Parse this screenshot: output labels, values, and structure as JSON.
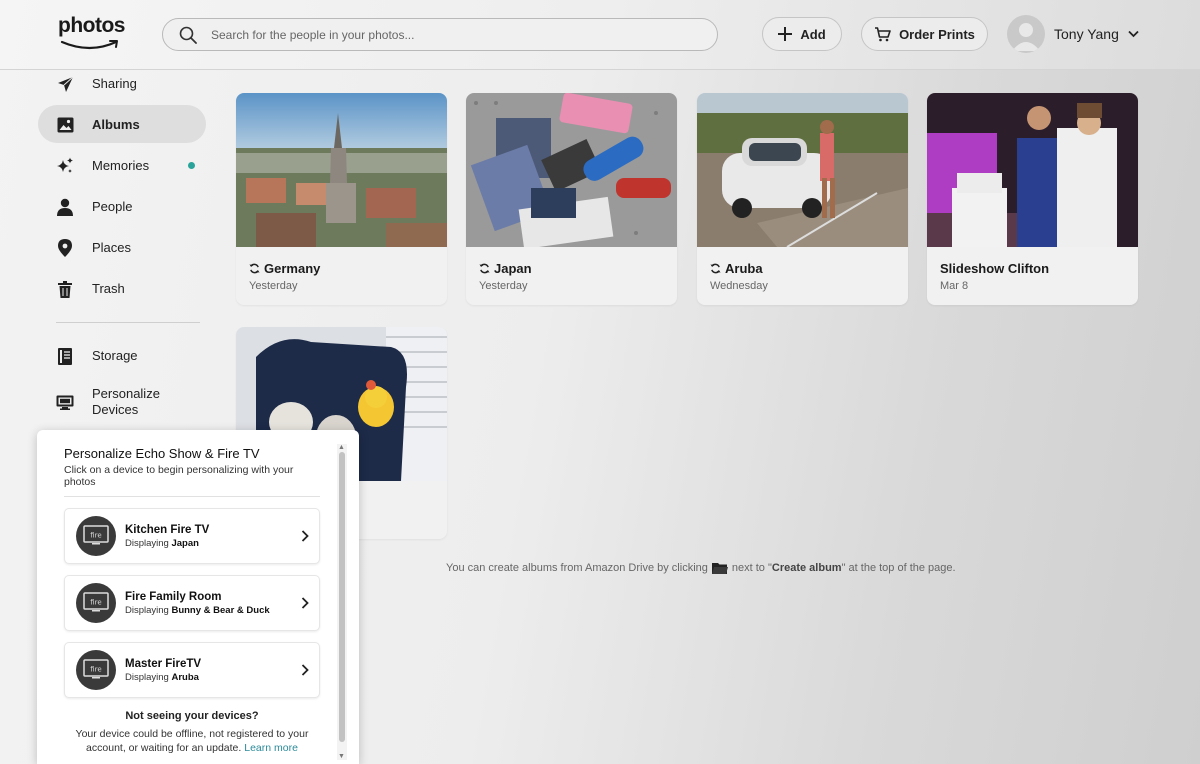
{
  "header": {
    "logo_text": "photos",
    "search_placeholder": "Search for the people in your photos...",
    "add_label": "Add",
    "order_prints_label": "Order Prints",
    "user_name": "Tony Yang"
  },
  "sidebar": {
    "items": [
      {
        "label": "Sharing",
        "icon": "paper-plane-icon"
      },
      {
        "label": "Albums",
        "icon": "album-icon",
        "active": true
      },
      {
        "label": "Memories",
        "icon": "sparkle-icon",
        "badge_dot": true
      },
      {
        "label": "People",
        "icon": "person-icon"
      },
      {
        "label": "Places",
        "icon": "map-pin-icon"
      },
      {
        "label": "Trash",
        "icon": "trash-icon"
      },
      {
        "label": "Storage",
        "icon": "storage-icon"
      },
      {
        "label": "Personalize Devices",
        "label_line1": "Personalize",
        "label_line2": "Devices",
        "icon": "monitor-icon"
      }
    ]
  },
  "albums": [
    {
      "title": "Germany",
      "subtitle": "Yesterday",
      "synced": true
    },
    {
      "title": "Japan",
      "subtitle": "Yesterday",
      "synced": true
    },
    {
      "title": "Aruba",
      "subtitle": "Wednesday",
      "synced": true
    },
    {
      "title": "Slideshow Clifton",
      "subtitle": "Mar 8",
      "synced": false
    },
    {
      "title": "",
      "subtitle": "",
      "synced": false
    }
  ],
  "hint": {
    "before": "You can create albums from Amazon Drive by clicking",
    "after": "next to \"",
    "bold": "Create album",
    "end": "\" at the top of the page."
  },
  "popup": {
    "title": "Personalize Echo Show & Fire TV",
    "description": "Click on a device to begin personalizing with your photos",
    "devices": [
      {
        "name": "Kitchen Fire TV",
        "displaying_prefix": "Displaying",
        "displaying": "Japan"
      },
      {
        "name": "Fire Family Room",
        "displaying_prefix": "Displaying",
        "displaying": "Bunny & Bear & Duck"
      },
      {
        "name": "Master FireTV",
        "displaying_prefix": "Displaying",
        "displaying": "Aruba"
      }
    ],
    "device_icon_text": "fire",
    "not_seeing_title": "Not seeing your devices?",
    "not_seeing_desc": "Your device could be offline, not registered to your account, or waiting for an update.",
    "learn_more": "Learn more"
  },
  "colors": {
    "accent_teal": "#2aa49a",
    "link": "#2a8b9a"
  }
}
